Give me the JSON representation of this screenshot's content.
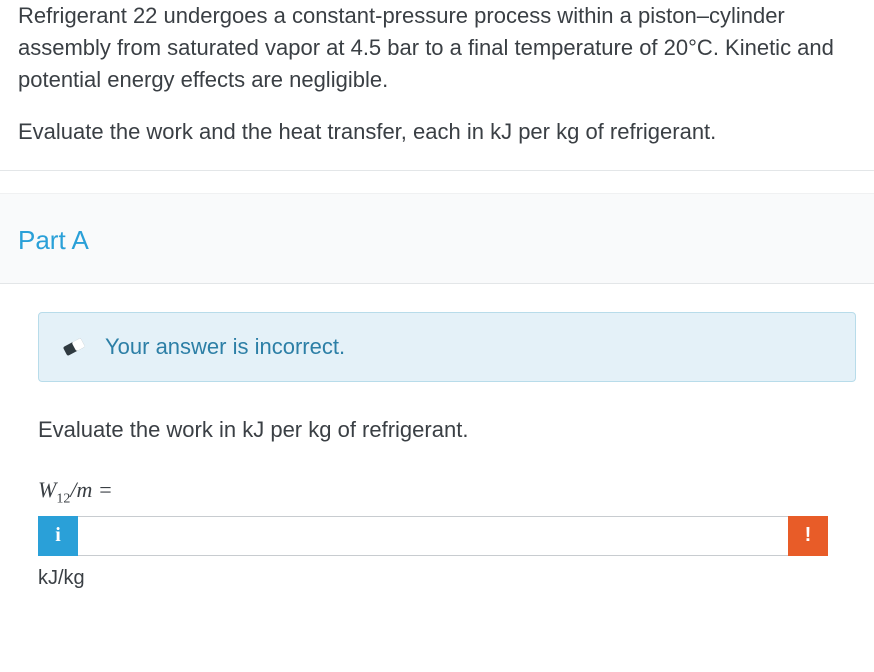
{
  "question": {
    "paragraph1": "Refrigerant 22 undergoes a constant-pressure process within a piston–cylinder assembly from saturated vapor at 4.5 bar to a final temperature of 20°C. Kinetic and potential energy effects are negligible.",
    "paragraph2": "Evaluate the work and the heat transfer, each in kJ per kg of refrigerant."
  },
  "partA": {
    "title": "Part A",
    "feedback": "Your answer is incorrect.",
    "subprompt": "Evaluate the work in kJ per kg of refrigerant.",
    "varLabelW": "W",
    "varLabelSub": "12",
    "varLabelRest": "/m =",
    "input": {
      "value": "",
      "placeholder": ""
    },
    "unit": "kJ/kg",
    "infoGlyph": "i",
    "warnGlyph": "!"
  }
}
